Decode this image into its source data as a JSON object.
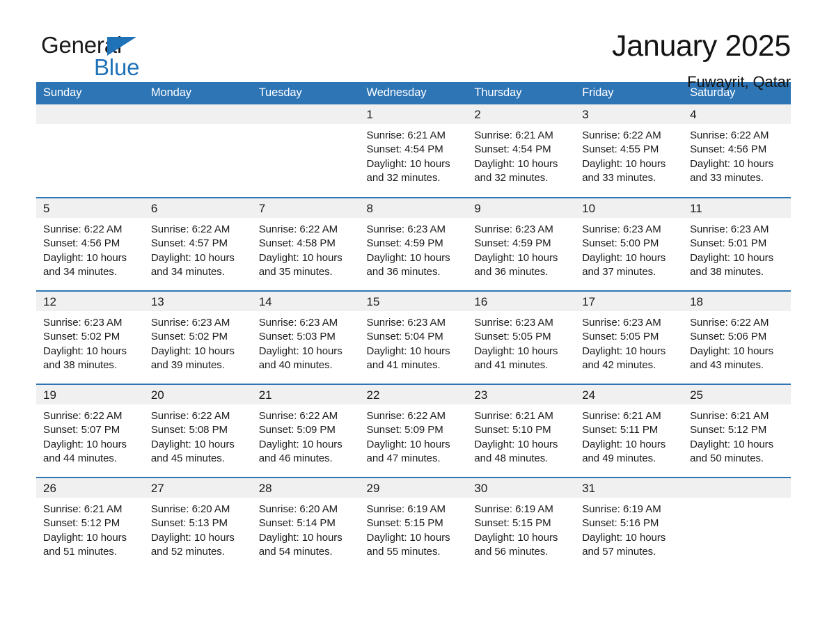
{
  "brand": {
    "line1": "General",
    "line2": "Blue",
    "accent_color": "#1f72b8",
    "text_color": "#1a1a1a"
  },
  "header": {
    "title": "January 2025",
    "location": "Fuwayrit, Qatar"
  },
  "theme": {
    "header_band": "#2e75b6",
    "row_border": "#2e75b6",
    "daynum_band": "#f0f0f0",
    "page_background": "#ffffff"
  },
  "calendar": {
    "weekday_headers": [
      "Sunday",
      "Monday",
      "Tuesday",
      "Wednesday",
      "Thursday",
      "Friday",
      "Saturday"
    ],
    "weeks": [
      [
        {
          "day": "",
          "sunrise": "",
          "sunset": "",
          "daylight_line1": "",
          "daylight_line2": "",
          "empty": true
        },
        {
          "day": "",
          "sunrise": "",
          "sunset": "",
          "daylight_line1": "",
          "daylight_line2": "",
          "empty": true
        },
        {
          "day": "",
          "sunrise": "",
          "sunset": "",
          "daylight_line1": "",
          "daylight_line2": "",
          "empty": true
        },
        {
          "day": "1",
          "sunrise": "Sunrise: 6:21 AM",
          "sunset": "Sunset: 4:54 PM",
          "daylight_line1": "Daylight: 10 hours",
          "daylight_line2": "and 32 minutes.",
          "empty": false
        },
        {
          "day": "2",
          "sunrise": "Sunrise: 6:21 AM",
          "sunset": "Sunset: 4:54 PM",
          "daylight_line1": "Daylight: 10 hours",
          "daylight_line2": "and 32 minutes.",
          "empty": false
        },
        {
          "day": "3",
          "sunrise": "Sunrise: 6:22 AM",
          "sunset": "Sunset: 4:55 PM",
          "daylight_line1": "Daylight: 10 hours",
          "daylight_line2": "and 33 minutes.",
          "empty": false
        },
        {
          "day": "4",
          "sunrise": "Sunrise: 6:22 AM",
          "sunset": "Sunset: 4:56 PM",
          "daylight_line1": "Daylight: 10 hours",
          "daylight_line2": "and 33 minutes.",
          "empty": false
        }
      ],
      [
        {
          "day": "5",
          "sunrise": "Sunrise: 6:22 AM",
          "sunset": "Sunset: 4:56 PM",
          "daylight_line1": "Daylight: 10 hours",
          "daylight_line2": "and 34 minutes.",
          "empty": false
        },
        {
          "day": "6",
          "sunrise": "Sunrise: 6:22 AM",
          "sunset": "Sunset: 4:57 PM",
          "daylight_line1": "Daylight: 10 hours",
          "daylight_line2": "and 34 minutes.",
          "empty": false
        },
        {
          "day": "7",
          "sunrise": "Sunrise: 6:22 AM",
          "sunset": "Sunset: 4:58 PM",
          "daylight_line1": "Daylight: 10 hours",
          "daylight_line2": "and 35 minutes.",
          "empty": false
        },
        {
          "day": "8",
          "sunrise": "Sunrise: 6:23 AM",
          "sunset": "Sunset: 4:59 PM",
          "daylight_line1": "Daylight: 10 hours",
          "daylight_line2": "and 36 minutes.",
          "empty": false
        },
        {
          "day": "9",
          "sunrise": "Sunrise: 6:23 AM",
          "sunset": "Sunset: 4:59 PM",
          "daylight_line1": "Daylight: 10 hours",
          "daylight_line2": "and 36 minutes.",
          "empty": false
        },
        {
          "day": "10",
          "sunrise": "Sunrise: 6:23 AM",
          "sunset": "Sunset: 5:00 PM",
          "daylight_line1": "Daylight: 10 hours",
          "daylight_line2": "and 37 minutes.",
          "empty": false
        },
        {
          "day": "11",
          "sunrise": "Sunrise: 6:23 AM",
          "sunset": "Sunset: 5:01 PM",
          "daylight_line1": "Daylight: 10 hours",
          "daylight_line2": "and 38 minutes.",
          "empty": false
        }
      ],
      [
        {
          "day": "12",
          "sunrise": "Sunrise: 6:23 AM",
          "sunset": "Sunset: 5:02 PM",
          "daylight_line1": "Daylight: 10 hours",
          "daylight_line2": "and 38 minutes.",
          "empty": false
        },
        {
          "day": "13",
          "sunrise": "Sunrise: 6:23 AM",
          "sunset": "Sunset: 5:02 PM",
          "daylight_line1": "Daylight: 10 hours",
          "daylight_line2": "and 39 minutes.",
          "empty": false
        },
        {
          "day": "14",
          "sunrise": "Sunrise: 6:23 AM",
          "sunset": "Sunset: 5:03 PM",
          "daylight_line1": "Daylight: 10 hours",
          "daylight_line2": "and 40 minutes.",
          "empty": false
        },
        {
          "day": "15",
          "sunrise": "Sunrise: 6:23 AM",
          "sunset": "Sunset: 5:04 PM",
          "daylight_line1": "Daylight: 10 hours",
          "daylight_line2": "and 41 minutes.",
          "empty": false
        },
        {
          "day": "16",
          "sunrise": "Sunrise: 6:23 AM",
          "sunset": "Sunset: 5:05 PM",
          "daylight_line1": "Daylight: 10 hours",
          "daylight_line2": "and 41 minutes.",
          "empty": false
        },
        {
          "day": "17",
          "sunrise": "Sunrise: 6:23 AM",
          "sunset": "Sunset: 5:05 PM",
          "daylight_line1": "Daylight: 10 hours",
          "daylight_line2": "and 42 minutes.",
          "empty": false
        },
        {
          "day": "18",
          "sunrise": "Sunrise: 6:22 AM",
          "sunset": "Sunset: 5:06 PM",
          "daylight_line1": "Daylight: 10 hours",
          "daylight_line2": "and 43 minutes.",
          "empty": false
        }
      ],
      [
        {
          "day": "19",
          "sunrise": "Sunrise: 6:22 AM",
          "sunset": "Sunset: 5:07 PM",
          "daylight_line1": "Daylight: 10 hours",
          "daylight_line2": "and 44 minutes.",
          "empty": false
        },
        {
          "day": "20",
          "sunrise": "Sunrise: 6:22 AM",
          "sunset": "Sunset: 5:08 PM",
          "daylight_line1": "Daylight: 10 hours",
          "daylight_line2": "and 45 minutes.",
          "empty": false
        },
        {
          "day": "21",
          "sunrise": "Sunrise: 6:22 AM",
          "sunset": "Sunset: 5:09 PM",
          "daylight_line1": "Daylight: 10 hours",
          "daylight_line2": "and 46 minutes.",
          "empty": false
        },
        {
          "day": "22",
          "sunrise": "Sunrise: 6:22 AM",
          "sunset": "Sunset: 5:09 PM",
          "daylight_line1": "Daylight: 10 hours",
          "daylight_line2": "and 47 minutes.",
          "empty": false
        },
        {
          "day": "23",
          "sunrise": "Sunrise: 6:21 AM",
          "sunset": "Sunset: 5:10 PM",
          "daylight_line1": "Daylight: 10 hours",
          "daylight_line2": "and 48 minutes.",
          "empty": false
        },
        {
          "day": "24",
          "sunrise": "Sunrise: 6:21 AM",
          "sunset": "Sunset: 5:11 PM",
          "daylight_line1": "Daylight: 10 hours",
          "daylight_line2": "and 49 minutes.",
          "empty": false
        },
        {
          "day": "25",
          "sunrise": "Sunrise: 6:21 AM",
          "sunset": "Sunset: 5:12 PM",
          "daylight_line1": "Daylight: 10 hours",
          "daylight_line2": "and 50 minutes.",
          "empty": false
        }
      ],
      [
        {
          "day": "26",
          "sunrise": "Sunrise: 6:21 AM",
          "sunset": "Sunset: 5:12 PM",
          "daylight_line1": "Daylight: 10 hours",
          "daylight_line2": "and 51 minutes.",
          "empty": false
        },
        {
          "day": "27",
          "sunrise": "Sunrise: 6:20 AM",
          "sunset": "Sunset: 5:13 PM",
          "daylight_line1": "Daylight: 10 hours",
          "daylight_line2": "and 52 minutes.",
          "empty": false
        },
        {
          "day": "28",
          "sunrise": "Sunrise: 6:20 AM",
          "sunset": "Sunset: 5:14 PM",
          "daylight_line1": "Daylight: 10 hours",
          "daylight_line2": "and 54 minutes.",
          "empty": false
        },
        {
          "day": "29",
          "sunrise": "Sunrise: 6:19 AM",
          "sunset": "Sunset: 5:15 PM",
          "daylight_line1": "Daylight: 10 hours",
          "daylight_line2": "and 55 minutes.",
          "empty": false
        },
        {
          "day": "30",
          "sunrise": "Sunrise: 6:19 AM",
          "sunset": "Sunset: 5:15 PM",
          "daylight_line1": "Daylight: 10 hours",
          "daylight_line2": "and 56 minutes.",
          "empty": false
        },
        {
          "day": "31",
          "sunrise": "Sunrise: 6:19 AM",
          "sunset": "Sunset: 5:16 PM",
          "daylight_line1": "Daylight: 10 hours",
          "daylight_line2": "and 57 minutes.",
          "empty": false
        },
        {
          "day": "",
          "sunrise": "",
          "sunset": "",
          "daylight_line1": "",
          "daylight_line2": "",
          "empty": true
        }
      ]
    ]
  }
}
